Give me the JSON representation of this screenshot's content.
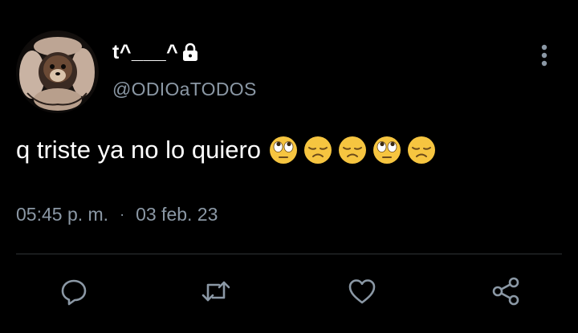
{
  "tweet": {
    "display_name": "t^___^",
    "handle": "@ODIOaTODOS",
    "text": "q triste ya no lo quiero",
    "emojis": [
      "face-with-rolling-eyes",
      "disappointed-face",
      "disappointed-face",
      "face-with-rolling-eyes",
      "disappointed-face"
    ],
    "time": "05:45 p. m.",
    "separator": "·",
    "date": "03 feb. 23"
  },
  "icons": {
    "protected": "lock-icon",
    "more": "more-vertical-icon",
    "reply": "reply-icon",
    "retweet": "retweet-icon",
    "like": "heart-icon",
    "share": "share-icon"
  },
  "colors": {
    "background": "#000000",
    "primary_text": "#ffffff",
    "secondary_text": "#8b98a5",
    "divider": "#2f3336"
  }
}
